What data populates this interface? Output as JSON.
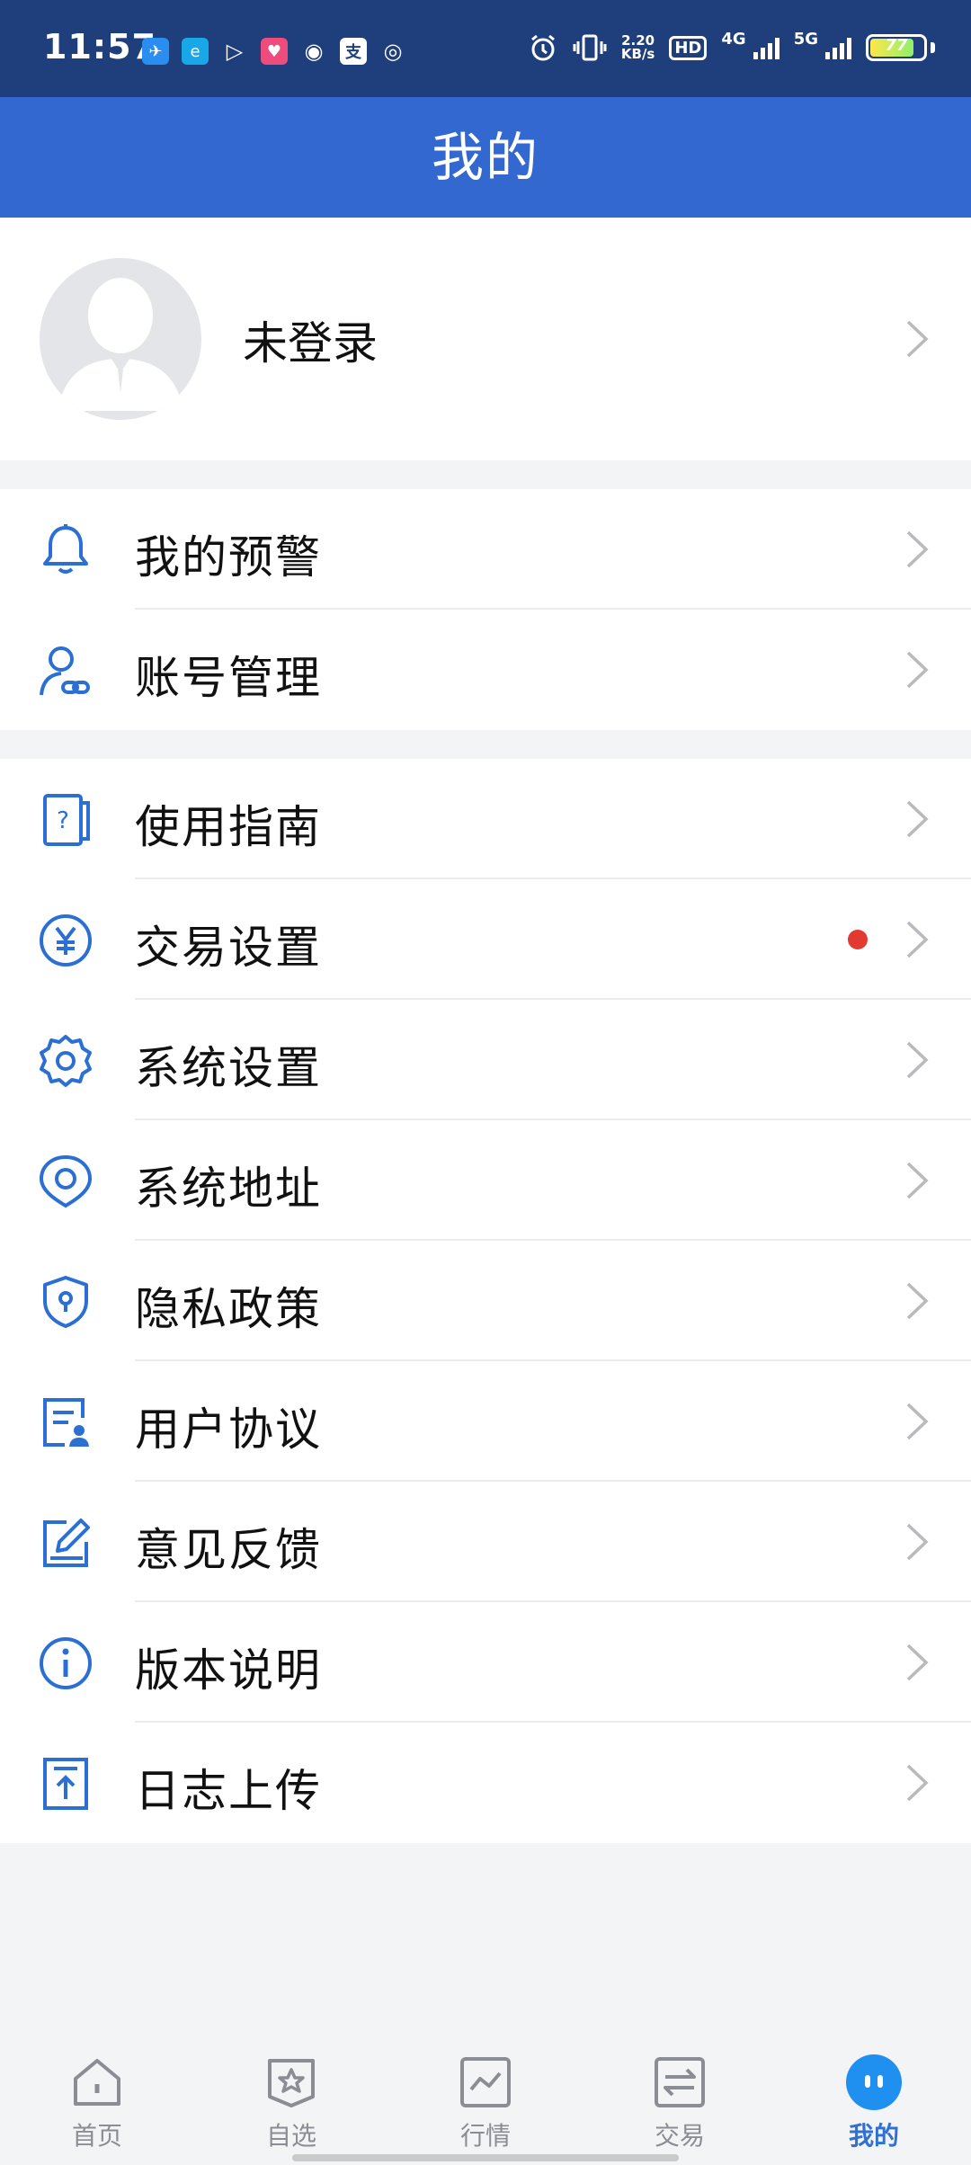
{
  "status_bar": {
    "time": "11:57",
    "speed_value": "2.20",
    "speed_unit": "KB/s",
    "hd_label": "HD",
    "net_4g": "4G",
    "net_5g": "5G",
    "battery_level": "77"
  },
  "header": {
    "title": "我的"
  },
  "profile": {
    "login_label": "未登录"
  },
  "menu_group_1": [
    {
      "label": "我的预警",
      "icon": "bell-icon"
    },
    {
      "label": "账号管理",
      "icon": "account-link-icon"
    }
  ],
  "menu_group_2": [
    {
      "label": "使用指南",
      "icon": "guide-book-icon"
    },
    {
      "label": "交易设置",
      "icon": "yuan-circle-icon",
      "badge": "red-dot"
    },
    {
      "label": "系统设置",
      "icon": "gear-icon"
    },
    {
      "label": "系统地址",
      "icon": "location-icon"
    },
    {
      "label": "隐私政策",
      "icon": "shield-lock-icon"
    },
    {
      "label": "用户协议",
      "icon": "agreement-doc-icon"
    },
    {
      "label": "意见反馈",
      "icon": "edit-feedback-icon"
    },
    {
      "label": "版本说明",
      "icon": "info-icon"
    },
    {
      "label": "日志上传",
      "icon": "upload-log-icon"
    }
  ],
  "tabs": [
    {
      "label": "首页",
      "icon": "home-icon"
    },
    {
      "label": "自选",
      "icon": "star-badge-icon"
    },
    {
      "label": "行情",
      "icon": "trend-chart-icon"
    },
    {
      "label": "交易",
      "icon": "exchange-icon"
    },
    {
      "label": "我的",
      "icon": "mine-face-icon",
      "active": true
    }
  ],
  "colors": {
    "status_bar": "#1f3f7c",
    "header": "#3368d0",
    "accent": "#2f6fd6",
    "badge_red": "#e23a30"
  }
}
